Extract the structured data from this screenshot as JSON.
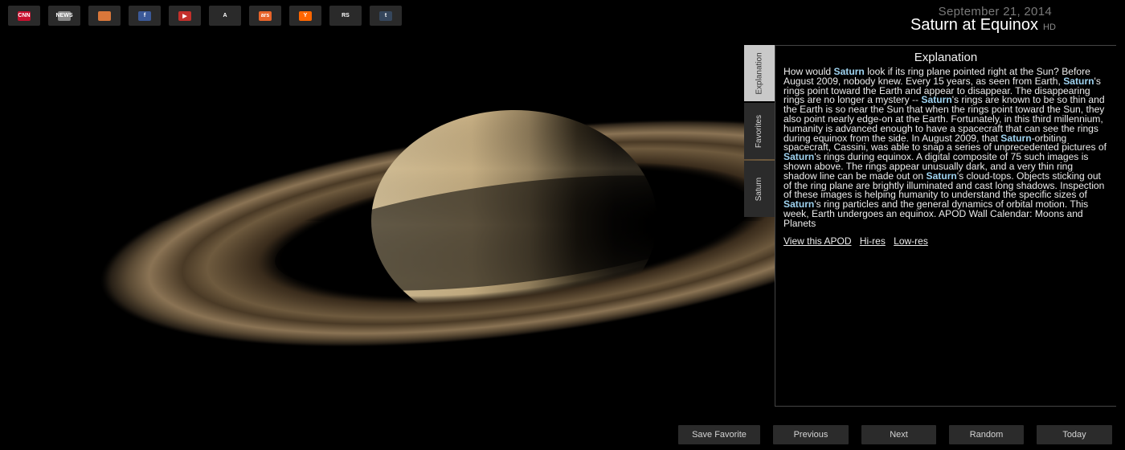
{
  "toolbar": {
    "icons": [
      {
        "name": "cnn-icon",
        "label": "CNN",
        "color": "#c8102e"
      },
      {
        "name": "news-icon",
        "label": "NEWS",
        "color": "#8a8a8a"
      },
      {
        "name": "store-icon",
        "label": "",
        "color": "#d9773a"
      },
      {
        "name": "facebook-icon",
        "label": "f",
        "color": "#3b5998"
      },
      {
        "name": "youtube-icon",
        "label": "▶",
        "color": "#c4302b"
      },
      {
        "name": "atlantic-icon",
        "label": "A",
        "color": "#2a2a2a"
      },
      {
        "name": "ars-icon",
        "label": "ars",
        "color": "#e8642a"
      },
      {
        "name": "ycombinator-icon",
        "label": "Y",
        "color": "#ff6600"
      },
      {
        "name": "rolling-stone-icon",
        "label": "RS",
        "color": "#2a2a2a"
      },
      {
        "name": "tumblr-icon",
        "label": "t",
        "color": "#35465c"
      }
    ]
  },
  "header": {
    "date": "September 21, 2014",
    "title": "Saturn at Equinox",
    "hd_label": "HD"
  },
  "tabs": [
    "Explanation",
    "Favorites",
    "Saturn"
  ],
  "explanation": {
    "heading": "Explanation",
    "segments": [
      {
        "t": "How would "
      },
      {
        "t": "Saturn",
        "h": true
      },
      {
        "t": " look if its ring plane pointed right at the Sun? Before August 2009, nobody knew. Every 15 years, as seen from Earth, "
      },
      {
        "t": "Saturn",
        "h": true
      },
      {
        "t": "'s rings point toward the Earth and appear to disappear. The disappearing rings are no longer a mystery -- "
      },
      {
        "t": "Saturn",
        "h": true
      },
      {
        "t": "'s rings are known to be so thin and the Earth is so near the Sun that when the rings point toward the Sun, they also point nearly edge-on at the Earth. Fortunately, in this third millennium, humanity is advanced enough to have a spacecraft that can see the rings during equinox from the side. In August 2009, that "
      },
      {
        "t": "Saturn",
        "h": true
      },
      {
        "t": "-orbiting spacecraft, Cassini, was able to snap a series of unprecedented pictures of "
      },
      {
        "t": "Saturn",
        "h": true
      },
      {
        "t": "'s rings during equinox. A digital composite of 75 such images is shown above. The rings appear unusually dark, and a very thin ring shadow line can be made out on "
      },
      {
        "t": "Saturn",
        "h": true
      },
      {
        "t": "'s cloud-tops. Objects sticking out of the ring plane are brightly illuminated and cast long shadows. Inspection of these images is helping humanity to understand the specific sizes of "
      },
      {
        "t": "Saturn",
        "h": true
      },
      {
        "t": "'s ring particles and the general dynamics of orbital motion. This week, Earth undergoes an equinox. APOD Wall Calendar: Moons and Planets"
      }
    ],
    "links": [
      "View this APOD",
      "Hi-res",
      "Low-res"
    ]
  },
  "buttons": [
    "Save Favorite",
    "Previous",
    "Next",
    "Random",
    "Today"
  ]
}
